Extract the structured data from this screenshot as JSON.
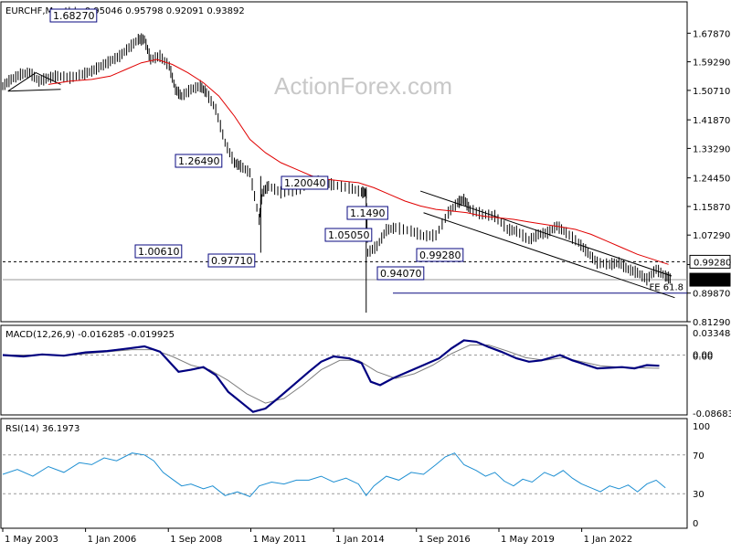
{
  "header": {
    "symbol_line": "EURCHF,Monthly  0.95046 0.95798 0.92091 0.93892"
  },
  "watermark": "ActionForex.com",
  "colors": {
    "price_bars": "#000000",
    "sma": "#e00000",
    "macd": "#000080",
    "signal": "#808080",
    "rsi": "#1e8fd2",
    "label_border": "#0a0a80",
    "grid": "#9a9a9a",
    "fe_line": "#0a0a80"
  },
  "chart_data": [
    {
      "type": "ohlc",
      "title": "EURCHF,Monthly",
      "ohlc": {
        "open": 0.95046,
        "high": 0.95798,
        "low": 0.92091,
        "close": 0.93892
      },
      "ylim": [
        0.8129,
        1.718
      ],
      "yticks": [
        "1.67870",
        "1.59290",
        "1.50710",
        "1.41870",
        "1.33290",
        "1.24450",
        "1.15870",
        "1.07290",
        "0.98440",
        "0.89870",
        "0.81290"
      ],
      "current_price_label": "0.93892",
      "level_label": "0.99280",
      "levels": [
        0.9928,
        0.93892
      ],
      "fe_label": "FE 61.8",
      "fe_level": 0.8987,
      "xticks": [
        "1 May 2003",
        "1 Jan 2006",
        "1 Sep 2008",
        "1 May 2011",
        "1 Jan 2014",
        "1 Sep 2016",
        "1 May 2019",
        "1 Jan 2022"
      ],
      "annotations": [
        "1.68270",
        "1.26490",
        "1.00610",
        "0.97710",
        "1.20040",
        "1.1490",
        "1.05050",
        "0.99280",
        "0.94070"
      ],
      "price_path": [
        [
          2003.33,
          1.52
        ],
        [
          2003.6,
          1.54
        ],
        [
          2003.9,
          1.555
        ],
        [
          2004.2,
          1.56
        ],
        [
          2004.5,
          1.535
        ],
        [
          2004.8,
          1.545
        ],
        [
          2005.1,
          1.55
        ],
        [
          2005.5,
          1.545
        ],
        [
          2005.9,
          1.555
        ],
        [
          2006.2,
          1.565
        ],
        [
          2006.5,
          1.58
        ],
        [
          2006.8,
          1.595
        ],
        [
          2007.1,
          1.61
        ],
        [
          2007.4,
          1.635
        ],
        [
          2007.7,
          1.66
        ],
        [
          2007.9,
          1.66
        ],
        [
          2008.1,
          1.6
        ],
        [
          2008.4,
          1.61
        ],
        [
          2008.7,
          1.58
        ],
        [
          2008.9,
          1.51
        ],
        [
          2009.1,
          1.49
        ],
        [
          2009.4,
          1.51
        ],
        [
          2009.7,
          1.52
        ],
        [
          2009.9,
          1.5
        ],
        [
          2010.2,
          1.45
        ],
        [
          2010.5,
          1.35
        ],
        [
          2010.8,
          1.29
        ],
        [
          2011.0,
          1.28
        ],
        [
          2011.3,
          1.26
        ],
        [
          2011.6,
          1.12
        ],
        [
          2011.7,
          1.2
        ],
        [
          2011.9,
          1.22
        ],
        [
          2012.3,
          1.201
        ],
        [
          2012.8,
          1.207
        ],
        [
          2013.3,
          1.235
        ],
        [
          2013.7,
          1.232
        ],
        [
          2014.0,
          1.223
        ],
        [
          2014.5,
          1.215
        ],
        [
          2014.9,
          1.202
        ],
        [
          2015.05,
          1.2
        ],
        [
          2015.1,
          1.02
        ],
        [
          2015.4,
          1.04
        ],
        [
          2015.7,
          1.088
        ],
        [
          2016.0,
          1.095
        ],
        [
          2016.5,
          1.085
        ],
        [
          2016.9,
          1.07
        ],
        [
          2017.3,
          1.072
        ],
        [
          2017.7,
          1.14
        ],
        [
          2018.0,
          1.17
        ],
        [
          2018.2,
          1.18
        ],
        [
          2018.4,
          1.15
        ],
        [
          2018.8,
          1.135
        ],
        [
          2019.2,
          1.13
        ],
        [
          2019.6,
          1.09
        ],
        [
          2019.9,
          1.085
        ],
        [
          2020.3,
          1.058
        ],
        [
          2020.6,
          1.075
        ],
        [
          2020.9,
          1.08
        ],
        [
          2021.2,
          1.1
        ],
        [
          2021.5,
          1.08
        ],
        [
          2021.9,
          1.05
        ],
        [
          2022.2,
          1.02
        ],
        [
          2022.5,
          0.99
        ],
        [
          2022.9,
          0.985
        ],
        [
          2023.2,
          0.99
        ],
        [
          2023.5,
          0.97
        ],
        [
          2023.8,
          0.96
        ],
        [
          2024.1,
          0.94
        ],
        [
          2024.4,
          0.97
        ],
        [
          2024.7,
          0.95
        ],
        [
          2024.9,
          0.94
        ]
      ],
      "sma_path": [
        [
          2004.8,
          1.525
        ],
        [
          2005.5,
          1.535
        ],
        [
          2006.2,
          1.54
        ],
        [
          2006.8,
          1.55
        ],
        [
          2007.3,
          1.57
        ],
        [
          2007.8,
          1.59
        ],
        [
          2008.3,
          1.6
        ],
        [
          2008.8,
          1.585
        ],
        [
          2009.3,
          1.56
        ],
        [
          2009.8,
          1.53
        ],
        [
          2010.3,
          1.49
        ],
        [
          2010.8,
          1.43
        ],
        [
          2011.3,
          1.36
        ],
        [
          2011.8,
          1.32
        ],
        [
          2012.3,
          1.29
        ],
        [
          2012.8,
          1.27
        ],
        [
          2013.3,
          1.25
        ],
        [
          2013.8,
          1.24
        ],
        [
          2014.3,
          1.235
        ],
        [
          2014.8,
          1.23
        ],
        [
          2015.3,
          1.215
        ],
        [
          2015.8,
          1.195
        ],
        [
          2016.3,
          1.175
        ],
        [
          2016.8,
          1.16
        ],
        [
          2017.3,
          1.15
        ],
        [
          2017.8,
          1.145
        ],
        [
          2018.3,
          1.14
        ],
        [
          2018.8,
          1.13
        ],
        [
          2019.3,
          1.125
        ],
        [
          2019.8,
          1.12
        ],
        [
          2020.3,
          1.112
        ],
        [
          2020.8,
          1.105
        ],
        [
          2021.3,
          1.098
        ],
        [
          2021.8,
          1.09
        ],
        [
          2022.3,
          1.075
        ],
        [
          2022.8,
          1.055
        ],
        [
          2023.3,
          1.035
        ],
        [
          2023.8,
          1.015
        ],
        [
          2024.3,
          1.0
        ],
        [
          2024.8,
          0.985
        ]
      ]
    },
    {
      "type": "line",
      "title": "MACD(12,26,9) -0.016285 -0.019925",
      "ylim": [
        -0.086837,
        0.033484
      ],
      "yticks": [
        "0.033484",
        "0.00",
        "0.00",
        "-0.086837"
      ],
      "macd_path": [
        [
          2003.33,
          0.0
        ],
        [
          2004.0,
          -0.002
        ],
        [
          2004.6,
          0.001
        ],
        [
          2005.3,
          -0.001
        ],
        [
          2006.0,
          0.004
        ],
        [
          2006.7,
          0.006
        ],
        [
          2007.4,
          0.01
        ],
        [
          2007.9,
          0.013
        ],
        [
          2008.4,
          0.005
        ],
        [
          2008.7,
          -0.01
        ],
        [
          2009.0,
          -0.025
        ],
        [
          2009.4,
          -0.022
        ],
        [
          2009.8,
          -0.018
        ],
        [
          2010.2,
          -0.03
        ],
        [
          2010.6,
          -0.055
        ],
        [
          2011.0,
          -0.07
        ],
        [
          2011.4,
          -0.085
        ],
        [
          2011.8,
          -0.08
        ],
        [
          2012.2,
          -0.065
        ],
        [
          2012.7,
          -0.045
        ],
        [
          2013.2,
          -0.025
        ],
        [
          2013.6,
          -0.01
        ],
        [
          2014.0,
          -0.002
        ],
        [
          2014.5,
          -0.005
        ],
        [
          2014.9,
          -0.012
        ],
        [
          2015.2,
          -0.04
        ],
        [
          2015.5,
          -0.045
        ],
        [
          2015.9,
          -0.035
        ],
        [
          2016.4,
          -0.025
        ],
        [
          2016.9,
          -0.015
        ],
        [
          2017.4,
          -0.005
        ],
        [
          2017.8,
          0.01
        ],
        [
          2018.2,
          0.022
        ],
        [
          2018.6,
          0.02
        ],
        [
          2019.0,
          0.012
        ],
        [
          2019.4,
          0.005
        ],
        [
          2019.9,
          -0.005
        ],
        [
          2020.3,
          -0.01
        ],
        [
          2020.7,
          -0.008
        ],
        [
          2021.0,
          -0.004
        ],
        [
          2021.3,
          0.0
        ],
        [
          2021.7,
          -0.008
        ],
        [
          2022.1,
          -0.014
        ],
        [
          2022.5,
          -0.02
        ],
        [
          2022.9,
          -0.019
        ],
        [
          2023.3,
          -0.018
        ],
        [
          2023.7,
          -0.02
        ],
        [
          2024.1,
          -0.015
        ],
        [
          2024.5,
          -0.016
        ]
      ],
      "signal_path": [
        [
          2003.33,
          0.0
        ],
        [
          2004.5,
          0.0
        ],
        [
          2005.5,
          0.0
        ],
        [
          2006.5,
          0.004
        ],
        [
          2007.5,
          0.008
        ],
        [
          2008.2,
          0.008
        ],
        [
          2008.8,
          -0.002
        ],
        [
          2009.4,
          -0.015
        ],
        [
          2010.0,
          -0.022
        ],
        [
          2010.6,
          -0.038
        ],
        [
          2011.2,
          -0.058
        ],
        [
          2011.8,
          -0.072
        ],
        [
          2012.4,
          -0.065
        ],
        [
          2013.0,
          -0.045
        ],
        [
          2013.6,
          -0.022
        ],
        [
          2014.2,
          -0.008
        ],
        [
          2014.8,
          -0.008
        ],
        [
          2015.4,
          -0.025
        ],
        [
          2016.0,
          -0.035
        ],
        [
          2016.6,
          -0.028
        ],
        [
          2017.2,
          -0.015
        ],
        [
          2017.8,
          0.002
        ],
        [
          2018.4,
          0.015
        ],
        [
          2019.0,
          0.015
        ],
        [
          2019.6,
          0.006
        ],
        [
          2020.2,
          -0.004
        ],
        [
          2020.8,
          -0.008
        ],
        [
          2021.4,
          -0.004
        ],
        [
          2022.0,
          -0.01
        ],
        [
          2022.6,
          -0.016
        ],
        [
          2023.2,
          -0.018
        ],
        [
          2023.8,
          -0.019
        ],
        [
          2024.5,
          -0.0199
        ]
      ]
    },
    {
      "type": "line",
      "title": "RSI(14) 36.1973",
      "ylim": [
        0,
        100
      ],
      "yticks": [
        "100",
        "70",
        "30",
        "0"
      ],
      "levels": [
        70,
        30
      ],
      "rsi_path": [
        [
          2003.33,
          50
        ],
        [
          2003.8,
          55
        ],
        [
          2004.3,
          48
        ],
        [
          2004.8,
          58
        ],
        [
          2005.3,
          52
        ],
        [
          2005.8,
          62
        ],
        [
          2006.2,
          60
        ],
        [
          2006.6,
          67
        ],
        [
          2007.0,
          64
        ],
        [
          2007.5,
          72
        ],
        [
          2007.9,
          70
        ],
        [
          2008.2,
          64
        ],
        [
          2008.5,
          52
        ],
        [
          2008.8,
          45
        ],
        [
          2009.1,
          38
        ],
        [
          2009.4,
          40
        ],
        [
          2009.8,
          35
        ],
        [
          2010.1,
          38
        ],
        [
          2010.5,
          28
        ],
        [
          2010.9,
          32
        ],
        [
          2011.3,
          27
        ],
        [
          2011.6,
          38
        ],
        [
          2012.0,
          42
        ],
        [
          2012.4,
          40
        ],
        [
          2012.8,
          44
        ],
        [
          2013.2,
          44
        ],
        [
          2013.6,
          48
        ],
        [
          2014.0,
          42
        ],
        [
          2014.4,
          46
        ],
        [
          2014.8,
          40
        ],
        [
          2015.05,
          28
        ],
        [
          2015.3,
          38
        ],
        [
          2015.7,
          48
        ],
        [
          2016.1,
          44
        ],
        [
          2016.5,
          52
        ],
        [
          2016.9,
          50
        ],
        [
          2017.3,
          60
        ],
        [
          2017.6,
          68
        ],
        [
          2017.9,
          72
        ],
        [
          2018.2,
          60
        ],
        [
          2018.6,
          54
        ],
        [
          2018.9,
          48
        ],
        [
          2019.2,
          52
        ],
        [
          2019.5,
          43
        ],
        [
          2019.8,
          38
        ],
        [
          2020.1,
          45
        ],
        [
          2020.4,
          42
        ],
        [
          2020.8,
          52
        ],
        [
          2021.1,
          48
        ],
        [
          2021.4,
          54
        ],
        [
          2021.7,
          46
        ],
        [
          2022.0,
          40
        ],
        [
          2022.3,
          36
        ],
        [
          2022.6,
          32
        ],
        [
          2022.9,
          38
        ],
        [
          2023.2,
          35
        ],
        [
          2023.5,
          39
        ],
        [
          2023.8,
          32
        ],
        [
          2024.1,
          40
        ],
        [
          2024.4,
          44
        ],
        [
          2024.7,
          36
        ]
      ]
    }
  ]
}
